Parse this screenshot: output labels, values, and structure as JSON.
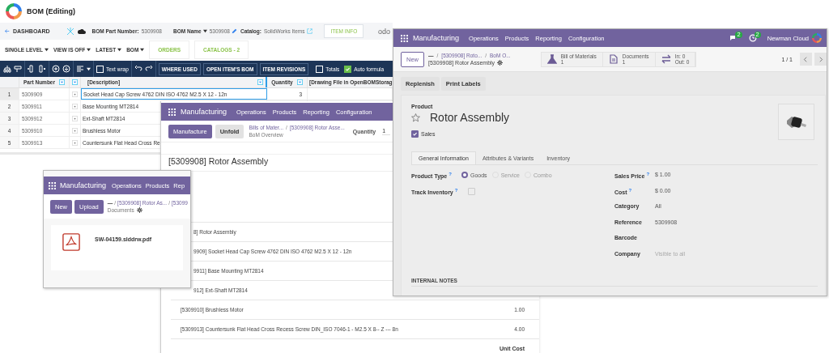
{
  "openbom": {
    "title": "BOM (Editing)",
    "back": "DASHBOARD",
    "part_number_label": "BOM Part Number:",
    "part_number": "5309908",
    "name_label": "BOM Name",
    "name": "5309908",
    "catalog_label": "Catalog:",
    "catalog": "SolidWorks Items",
    "info_button": "ITEM INFO",
    "partial_logo": "odo",
    "filters": [
      "SINGLE LEVEL",
      "VIEW IS OFF",
      "LATEST",
      "BOM"
    ],
    "tabs": [
      "ORDERS",
      "CATALOGS - 2"
    ],
    "toolbar": {
      "text_wrap": {
        "label": "Text wrap",
        "checked": false
      },
      "buttons": [
        "WHERE USED",
        "OPEN ITEM'S BOM",
        "ITEM REVISIONS"
      ],
      "toggles": [
        {
          "label": "Totals",
          "checked": false
        },
        {
          "label": "Auto formula",
          "checked": true
        }
      ]
    },
    "columns": [
      "Part Number",
      "[Description]",
      "Quantity",
      "[Drawing File in OpenBOMStorag"
    ],
    "rows": [
      {
        "index": "1",
        "part_number": "5309909",
        "description": "Socket Head Cap Screw 4762 DIN ISO 4762 M2.5 X 12 - 12n",
        "quantity": "3",
        "selected": true
      },
      {
        "index": "2",
        "part_number": "5309911",
        "description": "Base Mounting MT2814",
        "selected": false
      },
      {
        "index": "3",
        "part_number": "5309912",
        "description": "Ext-Shaft MT2814",
        "selected": false
      },
      {
        "index": "4",
        "part_number": "5309910",
        "description": "Brushless Motor",
        "selected": false
      },
      {
        "index": "5",
        "part_number": "5309913",
        "description": "Countersunk Flat Head Cross Re",
        "selected": false
      }
    ]
  },
  "bom_overview": {
    "nav": {
      "app": "Manufacturing",
      "menu": [
        "Operations",
        "Products",
        "Reporting",
        "Configuration"
      ]
    },
    "buttons": [
      {
        "label": "Manufacture",
        "kind": "primary"
      },
      {
        "label": "Unfold",
        "kind": "secondary"
      }
    ],
    "separator": "/",
    "breadcrumb": [
      "Bills of Mater...",
      "[5309908] Rotor Asse..."
    ],
    "page": "BoM Overview",
    "quantity_label": "Quantity",
    "quantity": "1",
    "title": "[5309908] Rotor Assembly",
    "lines": [
      {
        "kind": "covered",
        "name": "8] Rotor Assembly"
      },
      {
        "kind": "covered",
        "name": "9909] Socket Head Cap Screw 4762 DIN ISO 4762 M2.5 X 12 - 12n"
      },
      {
        "kind": "covered",
        "name": "9911] Base Mounting MT2814"
      },
      {
        "kind": "covered",
        "name": "912] Ext-Shaft MT2814"
      },
      {
        "kind": "component",
        "name": "[5309910] Brushless Motor",
        "quantity": "1.00"
      },
      {
        "kind": "component",
        "name": "[5309913] Countersunk Flat Head Cross Recess Screw DIN_ISO 7046-1 - M2.5 X 8-- Z --- 8n",
        "quantity": "4.00"
      }
    ],
    "footer": "Unit Cost"
  },
  "documents": {
    "nav": {
      "app": "Manufacturing",
      "menu": [
        "Operations",
        "Products",
        "Rep"
      ]
    },
    "buttons": [
      "New",
      "Upload"
    ],
    "separator": "/",
    "breadcrumb": [
      "—",
      "[5309908] Rotor As...",
      "[53099"
    ],
    "page": "Documents",
    "files": [
      {
        "name": "SW-04159.slddrw.pdf"
      }
    ]
  },
  "product": {
    "nav": {
      "app": "Manufacturing",
      "menu": [
        "Operations",
        "Products",
        "Reporting",
        "Configuration"
      ],
      "messages": "2",
      "activities": "2",
      "company": "Newman Cloud"
    },
    "new": "New",
    "separator": "/",
    "breadcrumb": [
      "—",
      "[5309908] Roto...",
      "BoM O..."
    ],
    "record": "[5309908] Rotor Assembly",
    "stats": [
      {
        "kind": "flask",
        "lines": [
          "Bill of Materials",
          "1"
        ]
      },
      {
        "kind": "document",
        "lines": [
          "Documents",
          "1"
        ]
      },
      {
        "kind": "transfer",
        "lines": [
          "In: 0",
          "Out: 0"
        ]
      }
    ],
    "pager": "1 / 1",
    "actions": [
      "Replenish",
      "Print Labels"
    ],
    "product_label": "Product",
    "name": "Rotor Assembly",
    "favorite": false,
    "sales": {
      "label": "Sales",
      "checked": true
    },
    "tabs": [
      {
        "label": "General Information",
        "selected": true
      },
      {
        "label": "Attributes & Variants",
        "selected": false
      },
      {
        "label": "Inventory",
        "selected": false
      }
    ],
    "product_type": {
      "label": "Product Type",
      "help": "?",
      "options": [
        {
          "label": "Goods",
          "selected": true
        },
        {
          "label": "Service",
          "selected": false
        },
        {
          "label": "Combo",
          "selected": false
        }
      ]
    },
    "track_inventory": {
      "label": "Track Inventory",
      "help": "?",
      "checked": false
    },
    "fields": [
      {
        "label": "Sales Price",
        "help": "?",
        "value": "$ 1.00"
      },
      {
        "label": "Cost",
        "help": "?",
        "value": "$ 0.00"
      },
      {
        "label": "Category",
        "value": "All"
      },
      {
        "label": "Reference",
        "value": "5309908"
      },
      {
        "label": "Barcode"
      },
      {
        "label": "Company",
        "placeholder": "Visible to all"
      }
    ],
    "notes_heading": "INTERNAL NOTES"
  }
}
